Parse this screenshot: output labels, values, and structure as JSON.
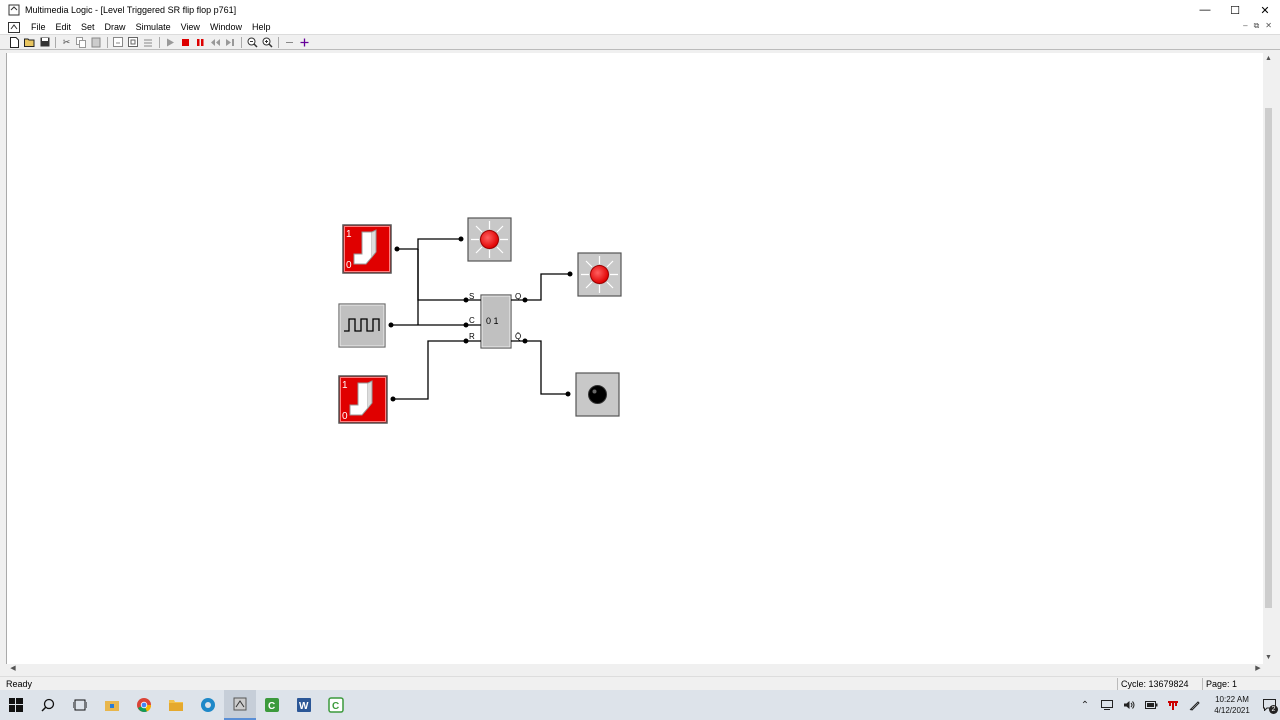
{
  "window": {
    "title": "Multimedia Logic - [Level Triggered SR flip flop p761]"
  },
  "menu": {
    "items": [
      "File",
      "Edit",
      "Set",
      "Draw",
      "Simulate",
      "View",
      "Window",
      "Help"
    ]
  },
  "toolbar": {
    "buttons": [
      "new-icon",
      "open-icon",
      "save-icon",
      "cut-icon",
      "copy-icon",
      "paste-icon",
      "undo-icon",
      "properties-icon",
      "align-icon",
      "run-icon",
      "stop-icon",
      "pause-icon",
      "step-back-icon",
      "step-forward-icon",
      "zoom-out-icon",
      "zoom-in-icon",
      "line-icon",
      "cross-icon"
    ]
  },
  "circuit": {
    "flipflop": {
      "inputs": [
        "S",
        "C",
        "R"
      ],
      "outputs": [
        "Q",
        "Q̄"
      ],
      "body_label": "0 1"
    },
    "switch_labels": {
      "high": "1",
      "low": "0"
    },
    "switch_top_state": "on",
    "switch_bottom_state": "on",
    "led_input_state": "on",
    "led_q_state": "on",
    "led_qbar_state": "off",
    "colors": {
      "switch_red": "#e00000",
      "led_on": "#ff0000",
      "led_off": "#000000",
      "wire": "#000000",
      "device_gray": "#c0c0c0"
    }
  },
  "status": {
    "ready": "Ready",
    "cycle": "Cycle: 13679824",
    "page": "Page: 1"
  },
  "taskbar": {
    "apps": [
      "start-icon",
      "search-icon",
      "task-view-icon",
      "store-icon",
      "chrome-icon",
      "file-explorer-icon",
      "edge-icon",
      "multimedia-logic-icon",
      "camtasia-icon",
      "word-icon",
      "camtasia-recorder-icon"
    ],
    "clock_time": "10:22 AM",
    "clock_date": "4/12/2021",
    "notification_count": "2"
  }
}
